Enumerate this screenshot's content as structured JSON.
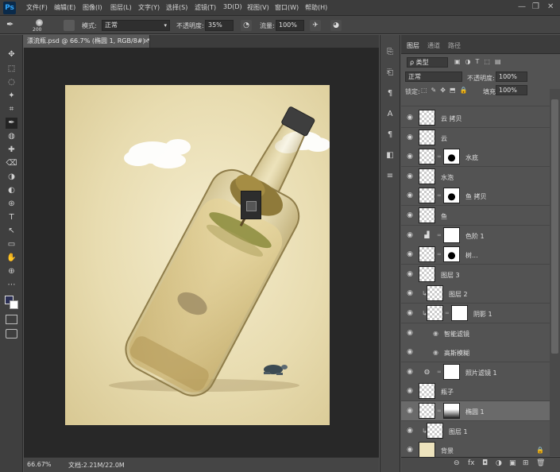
{
  "app": {
    "logo": "Ps"
  },
  "menu": [
    "文件(F)",
    "编辑(E)",
    "图像(I)",
    "图层(L)",
    "文字(Y)",
    "选择(S)",
    "滤镜(T)",
    "3D(D)",
    "视图(V)",
    "窗口(W)",
    "帮助(H)"
  ],
  "window_controls": [
    "—",
    "❐",
    "✕"
  ],
  "options": {
    "brush_size": "200",
    "mode_label": "模式:",
    "mode_value": "正常",
    "opacity_label": "不透明度:",
    "opacity_value": "35%",
    "flow_label": "流量:",
    "flow_value": "100%"
  },
  "document": {
    "tab_title": "漂流瓶.psd @ 66.7% (椭圆 1, RGB/8#) *",
    "close": "×",
    "zoom": "66.67%",
    "doc_info": "文档:2.21M/22.0M"
  },
  "tools": [
    "✥",
    "⬚",
    "◌",
    "✦",
    "⌗",
    "✒",
    "◍",
    "✚",
    "⌫",
    "◑",
    "◐",
    "⊛",
    "T",
    "↖",
    "▭",
    "✋",
    "⊕",
    "⋯"
  ],
  "side_icons": [
    "⎘",
    "⎗",
    "¶",
    "A",
    "¶",
    "◧",
    "≡"
  ],
  "panel": {
    "tabs": [
      "图层",
      "通道",
      "路径"
    ],
    "filter_label": "ρ 类型",
    "blend_mode": "正常",
    "opacity_label": "不透明度:",
    "opacity_value": "100%",
    "lock_label": "锁定:",
    "fill_label": "填充:",
    "fill_value": "100%"
  },
  "layers": [
    {
      "name": "云 拷贝",
      "mask": false
    },
    {
      "name": "云",
      "mask": false
    },
    {
      "name": "水底",
      "mask": true
    },
    {
      "name": "水泡",
      "mask": false
    },
    {
      "name": "鱼 拷贝",
      "mask": true
    },
    {
      "name": "鱼",
      "mask": false
    },
    {
      "name": "色阶 1",
      "mask": true,
      "adjustment": true
    },
    {
      "name": "树...",
      "mask": true
    },
    {
      "name": "图层 3",
      "mask": false
    },
    {
      "name": "图层 2",
      "mask": false,
      "clipped": true
    },
    {
      "name": "阴影 1",
      "mask": true,
      "clipped": true
    },
    {
      "name": "智能滤镜",
      "mask": false,
      "sub": true
    },
    {
      "name": "高斯模糊",
      "mask": false,
      "sub": true
    },
    {
      "name": "照片滤镜 1",
      "mask": true,
      "adjustment": true
    },
    {
      "name": "瓶子",
      "mask": false
    },
    {
      "name": "椭圆 1",
      "mask": true,
      "selected": true
    },
    {
      "name": "图层 1",
      "mask": false,
      "clipped": true
    },
    {
      "name": "背景",
      "mask": false,
      "locked": true
    }
  ],
  "bottom_icons": [
    "⊖",
    "fx",
    "◘",
    "◑",
    "▣",
    "⊞",
    "🗑"
  ]
}
